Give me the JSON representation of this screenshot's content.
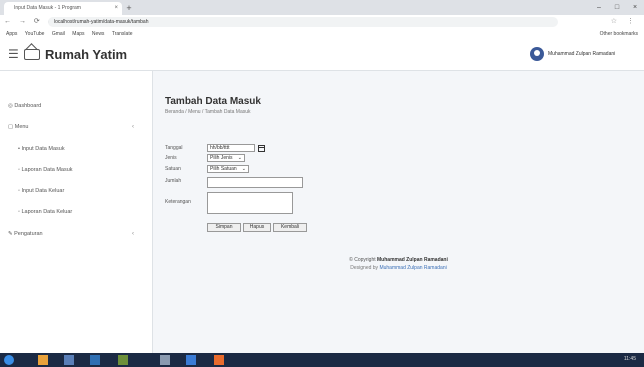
{
  "browser": {
    "tab_title": "Input Data Masuk - 1 Program",
    "tab_close": "×",
    "new_tab": "+",
    "url": "localhost/rumah-yatim/data-masuk/tambah",
    "nav": "← → ⟳ ⌂",
    "addr_right": "☆ ⋮",
    "window_controls": [
      "–",
      "□",
      "×"
    ],
    "bookmarks": [
      "Apps",
      "YouTube",
      "Gmail",
      "Maps",
      "News",
      "Translate"
    ],
    "bookmarks_right": "Other bookmarks"
  },
  "header": {
    "brand": "Rumah Yatim",
    "user_name": "Muhammad Zulpan Ramadani"
  },
  "sidebar": {
    "items": [
      {
        "label": "Dashboard"
      },
      {
        "label": "Menu",
        "caret": "‹"
      },
      {
        "label": "Input Data Masuk"
      },
      {
        "label": "Laporan Data Masuk"
      },
      {
        "label": "Input Data Keluar"
      },
      {
        "label": "Laporan Data Keluar"
      },
      {
        "label": "Pengaturan",
        "caret": "‹"
      }
    ]
  },
  "main": {
    "title": "Tambah Data Masuk",
    "breadcrumb": "Beranda / Menu / Tambah Data Masuk",
    "form": {
      "tanggal_label": "Tanggal",
      "tanggal_value": "hh/bb/tttt",
      "jenis_label": "Jenis",
      "jenis_value": "Pilih Jenis",
      "satuan_label": "Satuan",
      "satuan_value": "Pilih Satuan",
      "jumlah_label": "Jumlah",
      "keterangan_label": "Keterangan"
    },
    "buttons": {
      "simpan": "Simpan",
      "hapus": "Hapus",
      "kembali": "Kembali"
    },
    "footer": {
      "copyright_prefix": "© Copyright",
      "copyright_name": "Muhammad Zulpan Ramadani",
      "designed_prefix": "Designed by",
      "designed_name": "Muhammad Zulpan Ramadani"
    }
  },
  "taskbar": {
    "clock": "11:45"
  },
  "colors": {
    "avatar": "#3b5998",
    "taskbar": "#1b2a44"
  }
}
